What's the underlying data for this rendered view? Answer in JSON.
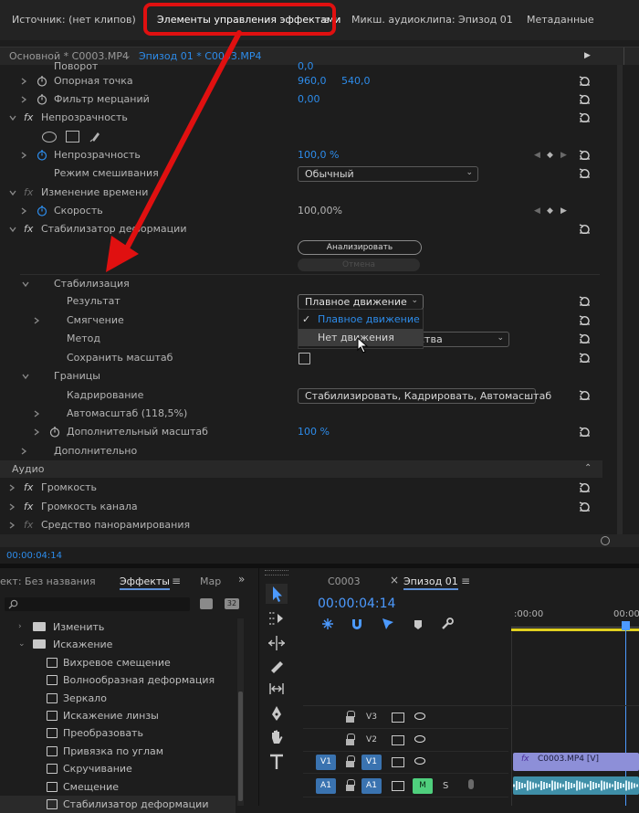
{
  "top_tabs": {
    "source": "Источник: (нет клипов)",
    "effect_controls": "Элементы управления эффектами",
    "audio_mixer": "Микш. аудиоклипа: Эпизод 01",
    "metadata": "Метаданные"
  },
  "clip_bar": {
    "master": "Основной * C0003.MP4",
    "sequence": "Эпизод 01 * C0003.MP4"
  },
  "effects": {
    "rotation_partial": "Поворот",
    "rotation_value": "0,0",
    "anchor_label": "Опорная точка",
    "anchor_x": "960,0",
    "anchor_y": "540,0",
    "flicker_label": "Фильтр мерцаний",
    "flicker_value": "0,00",
    "opacity_section": "Непрозрачность",
    "opacity_label": "Непрозрачность",
    "opacity_value": "100,0 %",
    "blend_label": "Режим смешивания",
    "blend_value": "Обычный",
    "time_remap_section": "Изменение времени",
    "speed_label": "Скорость",
    "speed_value": "100,00%",
    "stabilizer_section": "Стабилизатор деформации",
    "analyze_button": "Анализировать",
    "cancel_button": "Отмена",
    "stabilization_group": "Стабилизация",
    "result_label": "Результат",
    "result_value": "Плавное движение",
    "smoothing_label": "Смягчение",
    "method_label": "Метод",
    "method_value_partial": "ства",
    "preserve_scale_label": "Сохранить масштаб",
    "borders_group": "Границы",
    "framing_label": "Кадрирование",
    "framing_value": "Стабилизировать, Кадрировать, Автомасштаб",
    "autoscale_label": "Автомасштаб (118,5%)",
    "additional_scale_label": "Дополнительный масштаб",
    "additional_scale_value": "100 %",
    "advanced_label": "Дополнительно",
    "audio_header": "Аудио",
    "volume_label": "Громкость",
    "channel_volume_label": "Громкость канала",
    "panner_label": "Средство панорамирования"
  },
  "dropdown": {
    "options": [
      "Плавное движение",
      "Нет движения"
    ],
    "selected_index": 0
  },
  "effect_controls_timecode": "00:00:04:14",
  "project_panel": {
    "project_tab": "ект: Без названия",
    "effects_tab": "Эффекты",
    "markers_tab": "Мар",
    "tree": [
      {
        "label": "Изменить",
        "kind": "folder"
      },
      {
        "label": "Искажение",
        "kind": "folder"
      },
      {
        "label": "Вихревое смещение",
        "kind": "effect"
      },
      {
        "label": "Волнообразная деформация",
        "kind": "effect"
      },
      {
        "label": "Зеркало",
        "kind": "effect"
      },
      {
        "label": "Искажение линзы",
        "kind": "effect"
      },
      {
        "label": "Преобразовать",
        "kind": "effect"
      },
      {
        "label": "Привязка по углам",
        "kind": "effect"
      },
      {
        "label": "Скручивание",
        "kind": "effect"
      },
      {
        "label": "Смещение",
        "kind": "effect"
      },
      {
        "label": "Стабилизатор деформации",
        "kind": "effect"
      }
    ]
  },
  "timeline": {
    "tab1": "C0003",
    "tab2": "Эпизод 01",
    "timecode": "00:00:04:14",
    "ruler_left": ":00:00",
    "ruler_right": "00:00",
    "tracks": [
      {
        "source": "",
        "name": "V3"
      },
      {
        "source": "",
        "name": "V2"
      },
      {
        "source": "V1",
        "name": "V1"
      },
      {
        "source": "A1",
        "name": "A1",
        "mute": "M",
        "solo": "S"
      }
    ],
    "video_clip": "C0003.MP4 [V]"
  },
  "colors": {
    "accent_blue": "#2d8ceb",
    "highlight_red": "#e01010",
    "panel_bg": "#1d1d1d",
    "timeline_yellow": "#e0d020",
    "mute_green": "#4fcf7d"
  }
}
